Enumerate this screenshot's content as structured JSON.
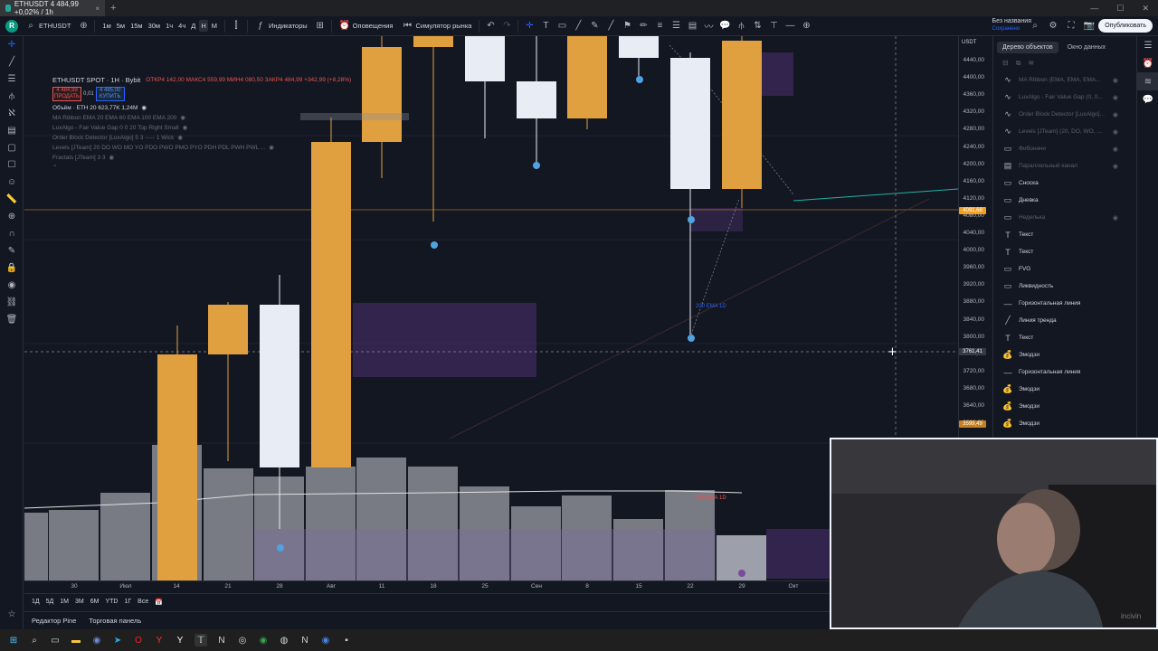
{
  "browser": {
    "tab_title": "ETHUSDT 4 484,99 +0,02% / 1h",
    "new_tab": "+"
  },
  "toolbar": {
    "symbol": "ETHUSDT",
    "intervals": [
      "1м",
      "5м",
      "15м",
      "30м",
      "1ч",
      "4ч",
      "Д",
      "Н",
      "М"
    ],
    "active_interval": "Н",
    "indicators_label": "Индикаторы",
    "alerts_label": "Оповещения",
    "replay_label": "Симулятор рынка",
    "layout_name": "Без названия",
    "layout_sub": "Сохранено",
    "publish_label": "Опубликовать"
  },
  "legend": {
    "title": "ETHUSDT SPOT · 1H · Bybit",
    "ohlc": "ОТКР4 142,00 МАКС4 559,99 МИН4 080,50 ЗАКР4 484,99 +342,99 (+8,28%)",
    "sell_price": "4 484,99",
    "sell_label": "ПРОДАТЬ",
    "spread": "0,01",
    "buy_price": "4 485,00",
    "buy_label": "КУПИТЬ",
    "volume": "Объём · ETH 20  623,77K  1,24M",
    "indicators": [
      "MA Ribbon EMA 20 EMA 60 EMA 100 EMA 200",
      "LuxAlgo - Fair Value Gap 0 0 20 Top Right Small",
      "Order Block Detector [LuxAlgo] 5 3 ----- 1 Wick",
      "Levels [JTeam] 20 DO WO MO YO PDO PWO PMO PYO PDH PDL PWH PWL ...",
      "Fractals [JTeam] 3 3"
    ]
  },
  "price_scale": {
    "currency": "USDT",
    "ticks": [
      "4440,00",
      "4400,00",
      "4360,00",
      "4320,00",
      "4280,00",
      "4240,00",
      "4200,00",
      "4160,00",
      "4120,00",
      "4080,00",
      "4040,00",
      "4000,00",
      "3960,00",
      "3920,00",
      "3880,00",
      "3840,00",
      "3800,00",
      "3760,00",
      "3720,00",
      "3680,00",
      "3640,00",
      "3600,00"
    ],
    "orange_tag_top": "4091,68",
    "crosshair_tag": "3761,41",
    "orange_tag_bottom": "3599,49"
  },
  "time_axis": {
    "labels": [
      "30",
      "Июл",
      "14",
      "21",
      "28",
      "Авг",
      "11",
      "18",
      "25",
      "Сен",
      "8",
      "15",
      "22",
      "29",
      "Окт"
    ]
  },
  "chart_labels": {
    "ema_label": "200 EMA 1D",
    "ema_label_2": "200 EMA 1D"
  },
  "bottom_range": [
    "1Д",
    "5Д",
    "1М",
    "3М",
    "6М",
    "YTD",
    "1Г",
    "Все"
  ],
  "bottom_panels": {
    "pine_editor": "Редактор Pine",
    "trading_panel": "Торговая панель"
  },
  "object_tree": {
    "tab_tree": "Дерево объектов",
    "tab_data": "Окно данных",
    "rows": [
      {
        "label": "MA Ribbon (EMA, EMA, EMA...",
        "icon": "indicator-icon",
        "dim": true
      },
      {
        "label": "LuxAlgo - Fair Value Gap (0, 0...",
        "icon": "indicator-icon",
        "dim": true
      },
      {
        "label": "Order Block Detector [LuxAlgo]...",
        "icon": "indicator-icon",
        "dim": true
      },
      {
        "label": "Levels [JTeam] (20, DO, WO, ...",
        "icon": "indicator-icon",
        "dim": true
      },
      {
        "label": "Фибоначи",
        "icon": "folder-icon",
        "dim": true
      },
      {
        "label": "Параллельный канал",
        "icon": "channel-icon",
        "dim": true
      },
      {
        "label": "Сноска",
        "icon": "callout-icon",
        "dim": false
      },
      {
        "label": "Дневка",
        "icon": "folder-icon",
        "dim": false
      },
      {
        "label": "Неделька",
        "icon": "folder-icon",
        "dim": true
      },
      {
        "label": "Текст",
        "icon": "text-icon",
        "dim": false
      },
      {
        "label": "Текст",
        "icon": "text-icon",
        "dim": false
      },
      {
        "label": "FVG",
        "icon": "folder-icon",
        "dim": false
      },
      {
        "label": "Ликвидность",
        "icon": "folder-icon",
        "dim": false
      },
      {
        "label": "Горизонтальная линия",
        "icon": "hline-icon",
        "dim": false
      },
      {
        "label": "Линия тренда",
        "icon": "trendline-icon",
        "dim": false
      },
      {
        "label": "Текст",
        "icon": "text-icon",
        "dim": false
      },
      {
        "label": "Эмодзи",
        "icon": "moneybag-icon",
        "dim": false
      },
      {
        "label": "Горизонтальная линия",
        "icon": "hline-icon",
        "dim": false
      },
      {
        "label": "Эмодзи",
        "icon": "moneybag-icon",
        "dim": false
      },
      {
        "label": "Эмодзи",
        "icon": "moneybag-icon",
        "dim": false
      },
      {
        "label": "Эмодзи",
        "icon": "moneybag-icon",
        "dim": false
      }
    ]
  },
  "webcam": {
    "watermark": "incivin"
  },
  "colors": {
    "bg": "#131722",
    "bull_candle": "#e8ecf5",
    "bear_candle": "#e0a040",
    "fvg": "#3d2a5c",
    "fractal": "#4fa3e0",
    "trendline": "#22b2a9",
    "orange_tag": "#f0a020"
  }
}
